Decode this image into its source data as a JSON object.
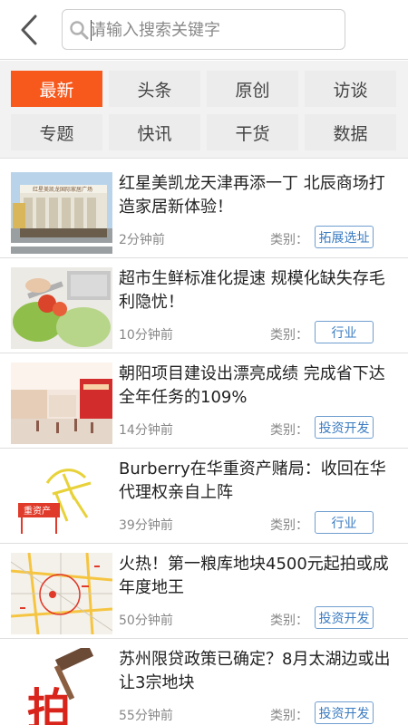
{
  "search": {
    "placeholder": "请输入搜索关键字"
  },
  "categories": [
    "最新",
    "头条",
    "原创",
    "访谈",
    "专题",
    "快讯",
    "干货",
    "数据"
  ],
  "active_category": "最新",
  "type_label": "类别：",
  "news": [
    {
      "title": "红星美凯龙天津再添一丁 北辰商场打造家居新体验！",
      "time": "2分钟前",
      "tag": "拓展选址"
    },
    {
      "title": "超市生鲜标准化提速 规模化缺失存毛利隐忧！",
      "time": "10分钟前",
      "tag": "行业"
    },
    {
      "title": "朝阳项目建设出漂亮成绩 完成省下达全年任务的109%",
      "time": "14分钟前",
      "tag": "投资开发"
    },
    {
      "title": "Burberry在华重资产赌局：收回在华代理权亲自上阵",
      "time": "39分钟前",
      "tag": "行业"
    },
    {
      "title": "火热！第一粮库地块4500元起拍或成年度地王",
      "time": "50分钟前",
      "tag": "投资开发"
    },
    {
      "title": "苏州限贷政策已确定？8月太湖边或出让3宗地块",
      "time": "55分钟前",
      "tag": "投资开发"
    }
  ],
  "thumbnail_texts": {
    "mall_sign": "红星美凯龙国际家居广场",
    "stamp": "重资产",
    "auction": "拍"
  },
  "colors": {
    "accent": "#f7581c",
    "tag_border": "#6f9ecf",
    "tag_text": "#3a7bc1"
  }
}
